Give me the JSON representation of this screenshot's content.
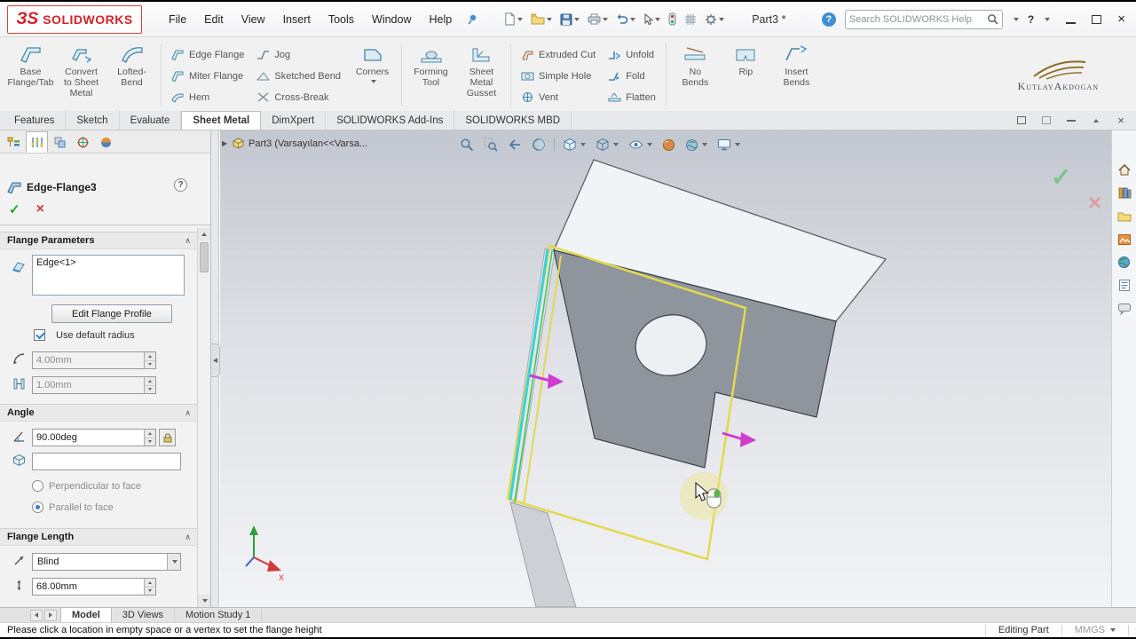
{
  "icons": {
    "caret": "▾",
    "check": "✓",
    "close": "×",
    "collapse": "∧",
    "flyout": "▶",
    "panel_collapse": "◀",
    "help": "?"
  },
  "titlebar": {
    "brand_mark": "ЗS",
    "brand": "SOLIDWORKS",
    "menus": [
      "File",
      "Edit",
      "View",
      "Insert",
      "Tools",
      "Window",
      "Help"
    ],
    "doc_title": "Part3 *",
    "search_placeholder": "Search SOLIDWORKS Help"
  },
  "ribbon": {
    "large_left": [
      "Base\nFlange/Tab",
      "Convert\nto Sheet\nMetal",
      "Lofted-Bend"
    ],
    "col1": [
      "Edge Flange",
      "Miter Flange",
      "Hem"
    ],
    "col2": [
      "Jog",
      "Sketched Bend",
      "Cross-Break"
    ],
    "corners": "Corners",
    "large_mid": [
      "Forming\nTool",
      "Sheet\nMetal\nGusset"
    ],
    "col3": [
      "Extruded Cut",
      "Simple Hole",
      "Vent"
    ],
    "col4": [
      "Unfold",
      "Fold",
      "Flatten"
    ],
    "large_right": [
      "No\nBends",
      "Rip",
      "Insert\nBends"
    ],
    "watermark": "KutlayAkdogan"
  },
  "tabs": {
    "items": [
      "Features",
      "Sketch",
      "Evaluate",
      "Sheet Metal",
      "DimXpert",
      "SOLIDWORKS Add-Ins",
      "SOLIDWORKS MBD"
    ]
  },
  "panel": {
    "title": "Edge-Flange3",
    "fp_header": "Flange Parameters",
    "selection": "Edge<1>",
    "edit_profile": "Edit Flange Profile",
    "use_default_radius": "Use default radius",
    "radius": "4.00mm",
    "gap": "1.00mm",
    "angle_header": "Angle",
    "angle": "90.00deg",
    "perpendicular": "Perpendicular to face",
    "parallel": "Parallel to face",
    "fl_header": "Flange Length",
    "end_condition": "Blind",
    "length": "68.00mm"
  },
  "viewport": {
    "doc_label": "Part3  (Varsayılan<<Varsa...",
    "triad_x": "X"
  },
  "bottom": {
    "tabs": [
      "Model",
      "3D Views",
      "Motion Study 1"
    ],
    "status": "Please click a location in empty space or a vertex to set the flange height",
    "mode": "Editing Part",
    "units": "MMGS"
  },
  "colors": {
    "brand_red": "#d1232a",
    "preview_yellow": "#e3d94e",
    "highlight_cyan": "#35d3d8",
    "arrow_magenta": "#cf3ccf",
    "confirm_green": "#27a33a",
    "cancel_red": "#d23c3c",
    "accent_blue": "#2f7fd6"
  }
}
